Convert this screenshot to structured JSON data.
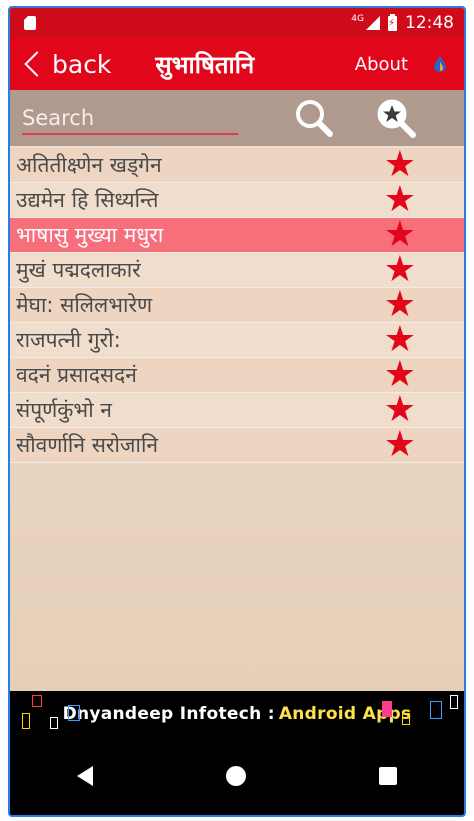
{
  "status": {
    "network": "4G",
    "time": "12:48"
  },
  "appbar": {
    "back_label": "back",
    "title": "सुभाषितानि",
    "about_label": "About"
  },
  "search": {
    "placeholder": "Search"
  },
  "list": {
    "items": [
      {
        "text": "अतितीक्ष्णेन खड्गेन",
        "favorite": true,
        "selected": false
      },
      {
        "text": "उद्यमेन हि सिध्यन्ति",
        "favorite": true,
        "selected": false
      },
      {
        "text": "भाषासु मुख्या मधुरा",
        "favorite": true,
        "selected": true
      },
      {
        "text": "मुखं पद्मदलाकारं",
        "favorite": true,
        "selected": false
      },
      {
        "text": "मेघा: सलिलभारेण",
        "favorite": true,
        "selected": false
      },
      {
        "text": "राजपत्नी गुरो:",
        "favorite": true,
        "selected": false
      },
      {
        "text": "वदनं प्रसादसदनं",
        "favorite": true,
        "selected": false
      },
      {
        "text": "संपूर्णकुंभो न",
        "favorite": true,
        "selected": false
      },
      {
        "text": "सौवर्णानि सरोजानि",
        "favorite": true,
        "selected": false
      }
    ]
  },
  "banner": {
    "company": "Dnyandeep Infotech :",
    "tagline": "Android Apps"
  },
  "icons": {
    "search": "search-icon",
    "favorite_search": "favorite-search-icon",
    "star": "star-icon",
    "back": "chevron-left-icon",
    "drop": "drop-icon"
  },
  "colors": {
    "accent": "#e1061a",
    "selected_row": "#f86f7c",
    "banner_yellow": "#ffe14a"
  }
}
